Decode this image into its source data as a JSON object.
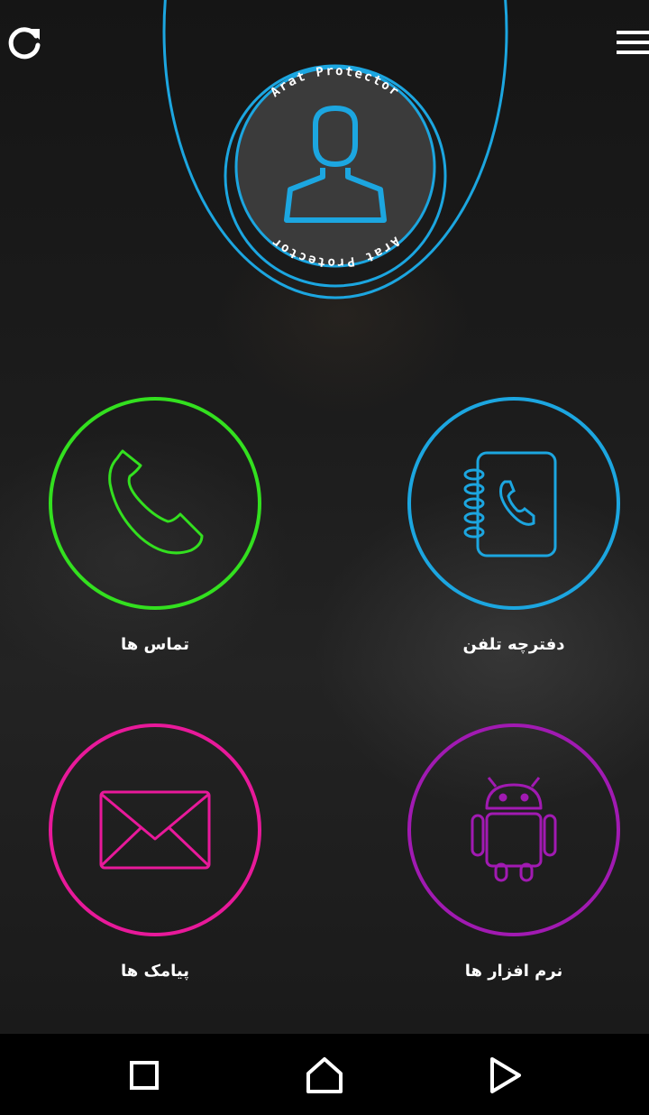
{
  "header": {
    "ring_text_top": "Arat Protector",
    "ring_text_bottom": "Arat Protector",
    "refresh_icon": "refresh-icon",
    "menu_icon": "hamburger-menu-icon",
    "avatar_icon": "user-avatar-icon"
  },
  "tiles": [
    {
      "id": "calls",
      "label": "تماس ها",
      "icon": "phone-icon",
      "color": "#33e01f"
    },
    {
      "id": "phonebook",
      "label": "دفترچه تلفن",
      "icon": "contacts-book-icon",
      "color": "#1ca6e0"
    },
    {
      "id": "messages",
      "label": "پیامک ها",
      "icon": "envelope-icon",
      "color": "#e8199a"
    },
    {
      "id": "apps",
      "label": "نرم افزار ها",
      "icon": "android-icon",
      "color": "#a11ab2"
    }
  ],
  "colors": {
    "accent_blue": "#1ca6e0"
  },
  "navbar": {
    "recents_icon": "square-recents-icon",
    "home_icon": "home-icon",
    "back_icon": "triangle-back-icon"
  }
}
